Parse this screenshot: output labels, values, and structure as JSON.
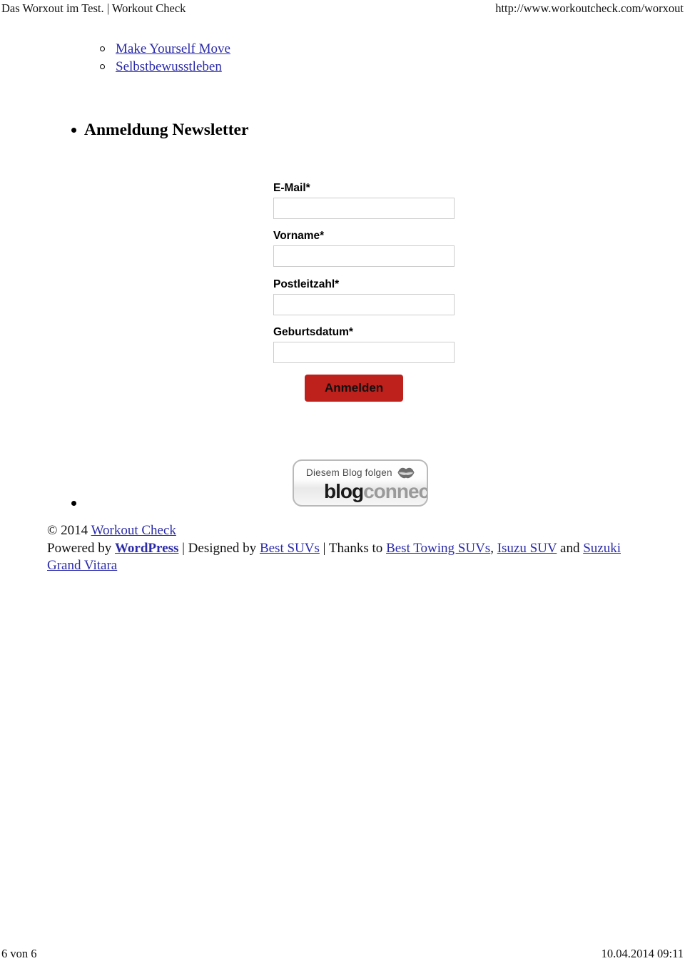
{
  "print_header": {
    "doc_title": "Das Worxout im Test. | Workout Check",
    "url": "http://www.workoutcheck.com/worxout"
  },
  "nav": {
    "sub_links": [
      {
        "label": "Make Yourself Move"
      },
      {
        "label": "Selbstbewusstleben"
      }
    ]
  },
  "newsletter": {
    "heading": "Anmeldung Newsletter",
    "fields": [
      {
        "label": "E-Mail*",
        "value": "",
        "placeholder": ""
      },
      {
        "label": "Vorname*",
        "value": "",
        "placeholder": ""
      },
      {
        "label": "Postleitzahl*",
        "value": "",
        "placeholder": ""
      },
      {
        "label": "Geburtsdatum*",
        "value": "",
        "placeholder": ""
      }
    ],
    "submit_label": "Anmelden",
    "submit_color": "#be201c"
  },
  "badge": {
    "tagline": "Diesem Blog folgen",
    "brand_primary": "blog",
    "brand_secondary": "connect",
    "icon": "lips-icon"
  },
  "footer": {
    "copyright_prefix": "© 2014 ",
    "site_link": "Workout Check",
    "powered_prefix": "Powered by ",
    "wordpress_link": "WordPress",
    "sep1": " | Designed by ",
    "best_suvs_link": "Best SUVs",
    "sep2": " | Thanks to ",
    "best_towing_link": "Best Towing SUVs",
    "comma": ", ",
    "isuzu_link": "Isuzu SUV",
    "and_text": " and ",
    "suzuki_link": "Suzuki Grand Vitara",
    "link_color": "#2b2baa"
  },
  "print_footer": {
    "page_indicator": "6 von 6",
    "timestamp": "10.04.2014 09:11"
  }
}
